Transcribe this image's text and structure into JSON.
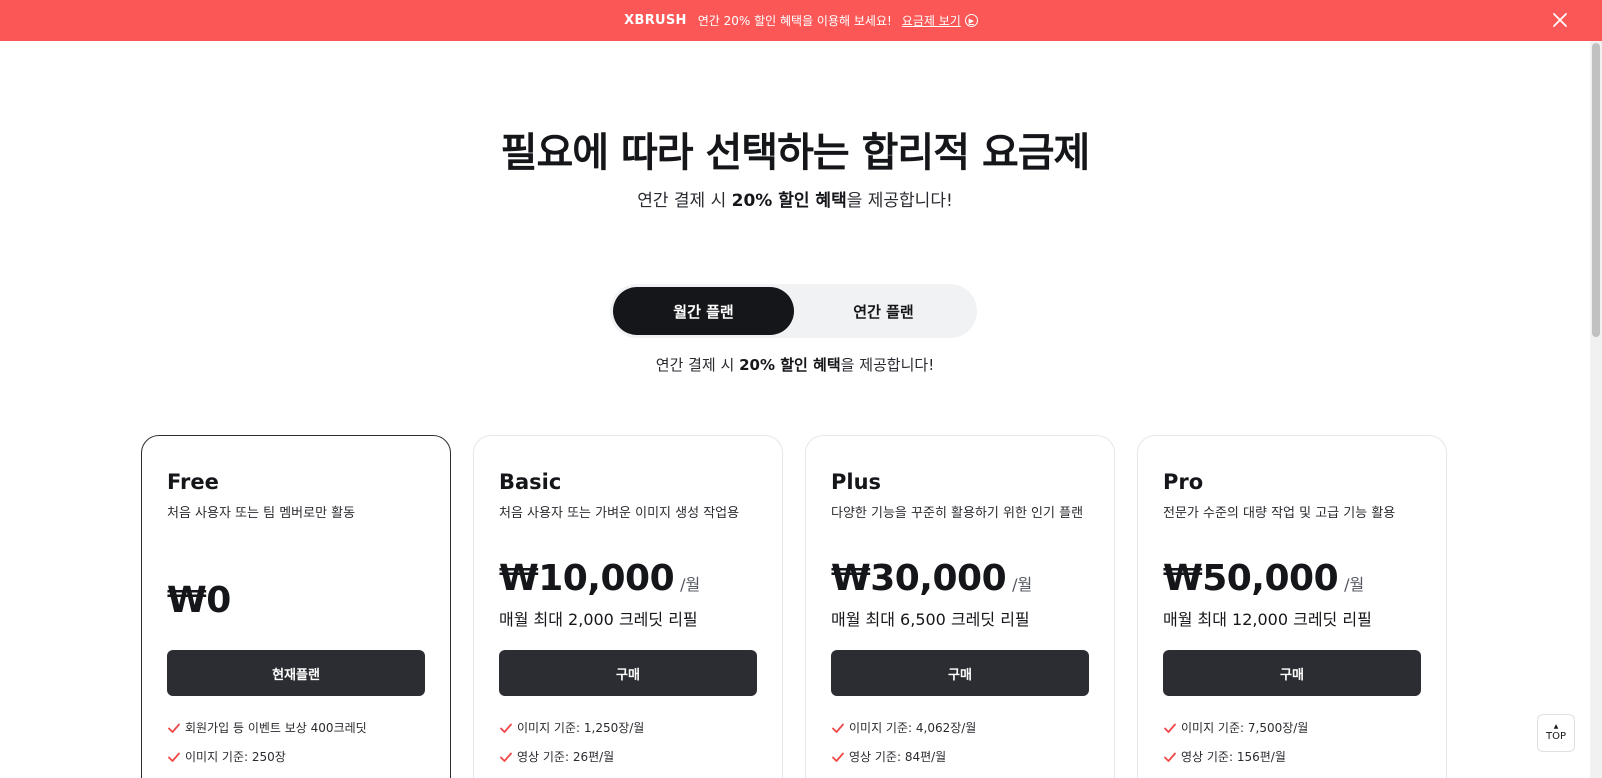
{
  "banner": {
    "brand": "XBRUSH",
    "message": "연간 20% 할인 혜택을 이용해 보세요!",
    "link_label": "요금제 보기",
    "link_icon": "chevron-right-circle-icon",
    "close_icon": "close-icon",
    "background": "#fb5757"
  },
  "hero": {
    "title": "필요에 따라 선택하는 합리적 요금제",
    "subtitle_pre": "연간 결제 시 ",
    "subtitle_bold": "20% 할인 혜택",
    "subtitle_post": "을 제공합니다!"
  },
  "billing_toggle": {
    "monthly_label": "월간 플랜",
    "yearly_label": "연간 플랜",
    "selected": "월간 플랜",
    "note_pre": "연간 결제 시 ",
    "note_bold": "20% 할인 혜택",
    "note_post": "을 제공합니다!"
  },
  "plans": [
    {
      "name": "Free",
      "description": "처음 사용자 또는 팀 멤버로만 활동",
      "price": "₩0",
      "per": "",
      "credits": "",
      "button_label": "현재플랜",
      "current": true,
      "features": [
        "회원가입 등 이벤트 보상 400크레딧",
        "이미지 기준: 250장"
      ]
    },
    {
      "name": "Basic",
      "description": "처음 사용자 또는 가벼운 이미지 생성 작업용",
      "price": "₩10,000",
      "per": "/월",
      "credits": "매월 최대 2,000 크레딧 리필",
      "button_label": "구매",
      "current": false,
      "features": [
        "이미지 기준: 1,250장/월",
        "영상 기준: 26편/월"
      ]
    },
    {
      "name": "Plus",
      "description": "다양한 기능을 꾸준히 활용하기 위한 인기 플랜",
      "price": "₩30,000",
      "per": "/월",
      "credits": "매월 최대 6,500 크레딧 리필",
      "button_label": "구매",
      "current": false,
      "features": [
        "이미지 기준: 4,062장/월",
        "영상 기준: 84편/월"
      ]
    },
    {
      "name": "Pro",
      "description": "전문가 수준의 대량 작업 및 고급 기능 활용",
      "price": "₩50,000",
      "per": "/월",
      "credits": "매월 최대 12,000 크레딧 리필",
      "button_label": "구매",
      "current": false,
      "features": [
        "이미지 기준: 7,500장/월",
        "영상 기준: 156편/월"
      ]
    }
  ],
  "check_icon": "check-icon",
  "check_color": "#f04848",
  "top_button": {
    "label": "TOP",
    "icon": "arrow-up-icon"
  }
}
